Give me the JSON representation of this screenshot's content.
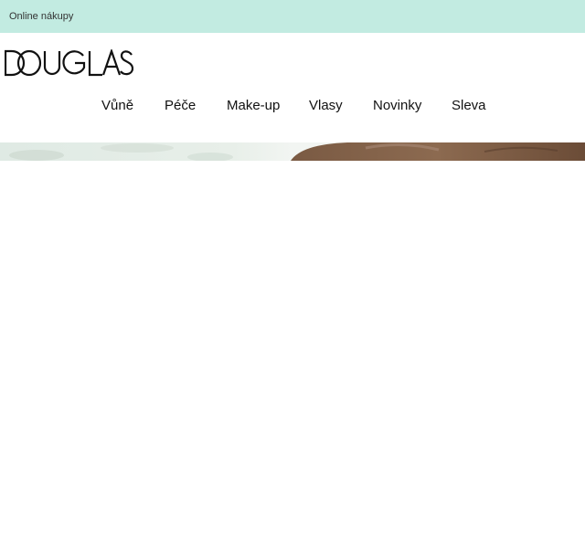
{
  "topbar": {
    "link_label": "Online nákupy"
  },
  "header": {
    "logo_text": "DOUGLAS"
  },
  "nav": {
    "items": [
      {
        "label": "Vůně"
      },
      {
        "label": "Péče"
      },
      {
        "label": "Make-up"
      },
      {
        "label": "Vlasy"
      },
      {
        "label": "Novinky"
      },
      {
        "label": "Sleva"
      }
    ]
  },
  "colors": {
    "topbar_bg": "#c2ebe1",
    "text": "#111111"
  },
  "icons": {
    "logo": "douglas-logo-icon"
  }
}
